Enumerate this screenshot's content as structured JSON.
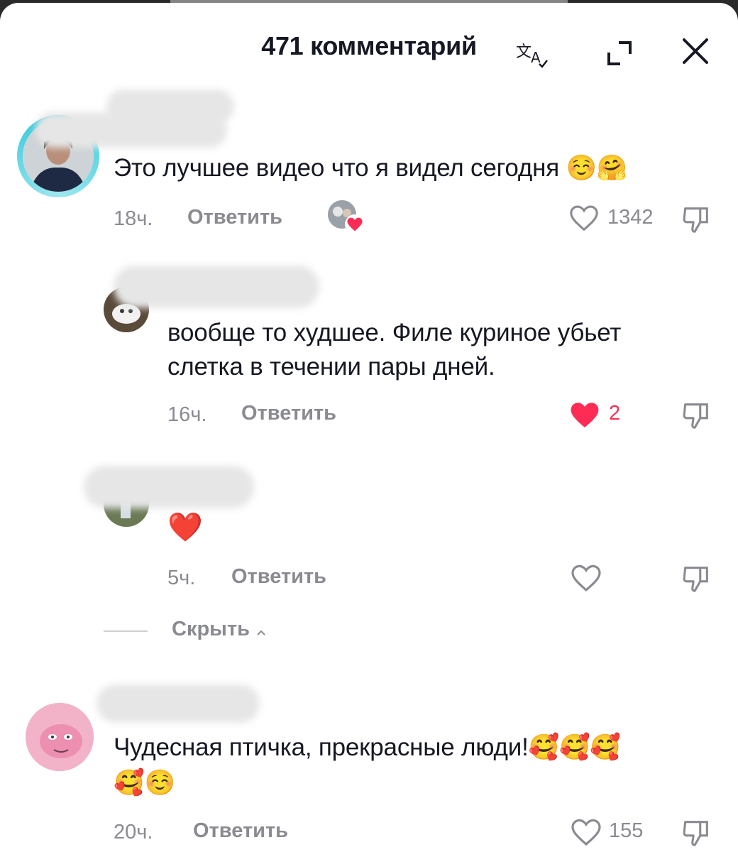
{
  "header": {
    "title": "471 комментарий"
  },
  "comments": [
    {
      "text": "Это лучшее видео что я видел сегодня",
      "emoji": "☺️🤗",
      "time": "18ч.",
      "reply_label": "Ответить",
      "likes": "1342",
      "liked": false,
      "creator_liked": true
    }
  ],
  "replies": [
    {
      "text_line1": "вообще то худшее. Филе куриное убьет",
      "text_line2": "слетка в течении пары дней.",
      "time": "16ч.",
      "reply_label": "Ответить",
      "likes": "2",
      "liked": true
    },
    {
      "text": "❤️",
      "time": "5ч.",
      "reply_label": "Ответить",
      "likes": "",
      "liked": false
    }
  ],
  "hide_label": "Скрыть",
  "comment2": {
    "text": "Чудесная птичка, прекрасные люди!",
    "emoji_line1": "🥰🥰🥰",
    "emoji_line2": "🥰☺️",
    "time": "20ч.",
    "reply_label": "Ответить",
    "likes": "155"
  },
  "colors": {
    "primary_text": "#161823",
    "secondary_text": "#8a8b91",
    "like_red": "#fe2c55",
    "ring": "#25c5d8"
  }
}
